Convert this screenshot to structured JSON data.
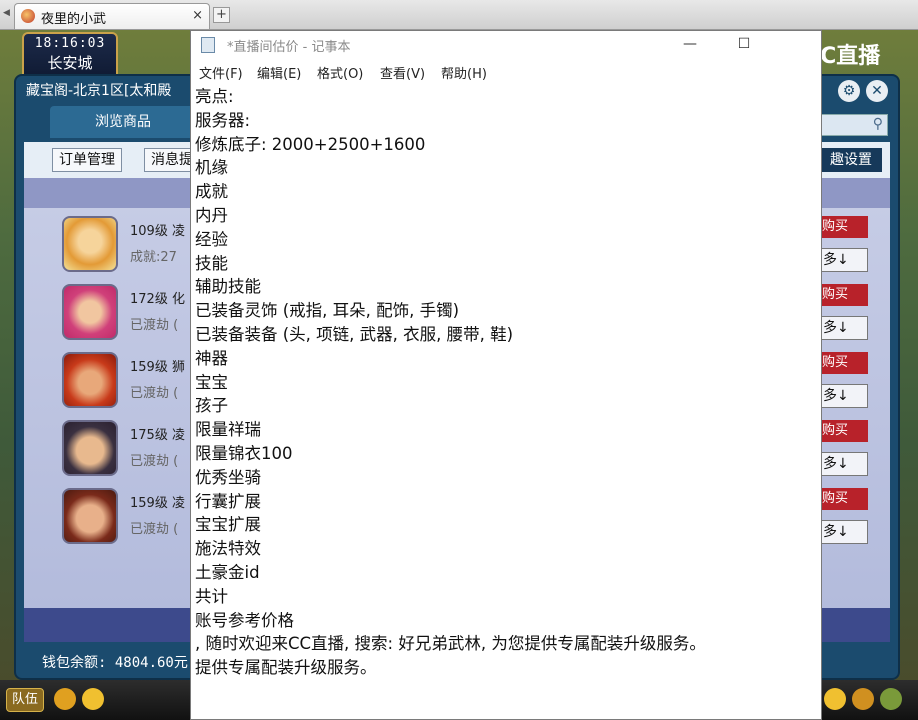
{
  "browser": {
    "tab_title": "夜里的小武",
    "tab_close": "×",
    "new_tab": "+"
  },
  "game": {
    "clock_time": "18:16:03",
    "city": "长安城",
    "watermark": "CC直播"
  },
  "trade_window": {
    "title": "藏宝阁-北京1区[太和殿",
    "browse_tab": "浏览商品",
    "order_mgmt": "订单管理",
    "messages": "消息提",
    "interest_settings": "趣设置",
    "buy_label": "购买",
    "more_label": "多↓",
    "rows": [
      {
        "level": "109级 凌",
        "sub": "成就:27"
      },
      {
        "level": "172级 化",
        "sub": "已渡劫 ("
      },
      {
        "level": "159级 狮",
        "sub": "已渡劫 ("
      },
      {
        "level": "175级 凌",
        "sub": "已渡劫 ("
      },
      {
        "level": "159级 凌",
        "sub": "已渡劫 ("
      }
    ],
    "wallet": "钱包余额: 4804.60元"
  },
  "bottom_bar": {
    "team_button": "队伍"
  },
  "notepad": {
    "title": "*直播间估价 - 记事本",
    "minimize": "—",
    "maximize": "☐",
    "menu": [
      "文件(F)",
      "编辑(E)",
      "格式(O)",
      "查看(V)",
      "帮助(H)"
    ],
    "lines": [
      "亮点:",
      "服务器:",
      "修炼底子: 2000+2500+1600",
      "机缘",
      "成就",
      "内丹",
      "经验",
      "技能",
      "辅助技能",
      "已装备灵饰 (戒指, 耳朵, 配饰, 手镯)",
      "已装备装备 (头, 项链, 武器, 衣服, 腰带, 鞋)",
      "神器",
      "宝宝",
      "孩子",
      "限量祥瑞",
      "限量锦衣100",
      "优秀坐骑",
      "行囊扩展",
      "宝宝扩展",
      "施法特效",
      "土豪金id",
      "共计",
      "账号参考价格",
      ", 随时欢迎来CC直播, 搜索: 好兄弟武林, 为您提供专属配装升级服务。",
      "提供专属配装升级服务。"
    ]
  },
  "colors": {
    "buy_red": "#b8222a",
    "trade_blue": "#1b4b6e",
    "list_lavender": "#c7cde6"
  }
}
